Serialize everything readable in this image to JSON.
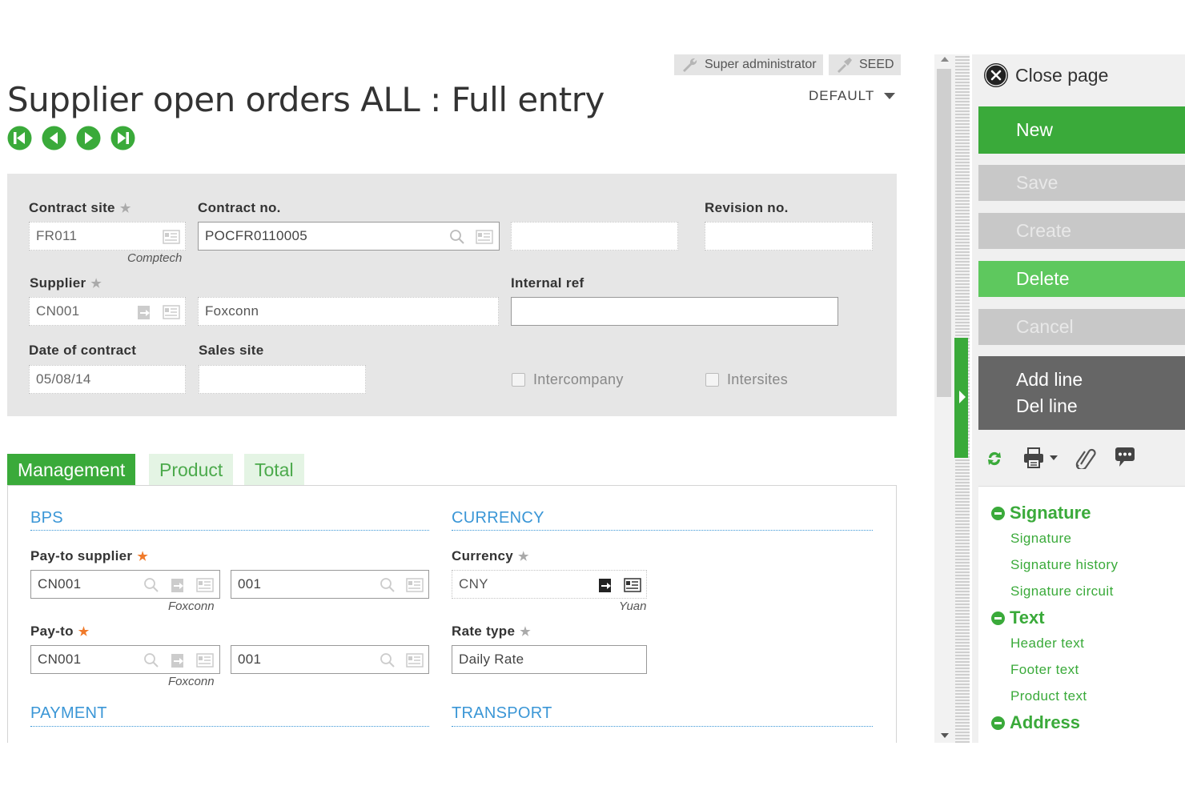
{
  "user": {
    "role": "Super administrator",
    "folder": "SEED"
  },
  "page": {
    "title": "Supplier open orders ALL : Full entry",
    "view": "DEFAULT"
  },
  "header": {
    "contract_site": {
      "label": "Contract site",
      "value": "FR011",
      "desc": "Comptech"
    },
    "contract_no": {
      "label": "Contract no.",
      "value": "POCFR0110005"
    },
    "revision_no": {
      "label": "Revision no.",
      "value": ""
    },
    "supplier": {
      "label": "Supplier",
      "value": "CN001",
      "name": "Foxconn"
    },
    "internal_ref": {
      "label": "Internal ref",
      "value": ""
    },
    "date_of_contract": {
      "label": "Date of contract",
      "value": "05/08/14"
    },
    "sales_site": {
      "label": "Sales site",
      "value": ""
    },
    "intercompany": {
      "label": "Intercompany",
      "checked": false
    },
    "intersites": {
      "label": "Intersites",
      "checked": false
    }
  },
  "tabs": [
    {
      "label": "Management",
      "active": true
    },
    {
      "label": "Product",
      "active": false
    },
    {
      "label": "Total",
      "active": false
    }
  ],
  "management": {
    "bps": {
      "title": "BPS",
      "pay_to_supplier": {
        "label": "Pay-to supplier",
        "value": "CN001",
        "address": "001",
        "desc": "Foxconn"
      },
      "pay_to": {
        "label": "Pay-to",
        "value": "CN001",
        "address": "001",
        "desc": "Foxconn"
      }
    },
    "currency": {
      "title": "CURRENCY",
      "currency": {
        "label": "Currency",
        "value": "CNY",
        "desc": "Yuan"
      },
      "rate_type": {
        "label": "Rate type",
        "value": "Daily Rate"
      }
    },
    "payment_title": "PAYMENT",
    "transport_title": "TRANSPORT"
  },
  "actions": {
    "close_page": "Close page",
    "new": "New",
    "save": "Save",
    "create": "Create",
    "delete": "Delete",
    "cancel": "Cancel",
    "add_line": "Add line",
    "del_line": "Del line"
  },
  "links": {
    "signature": {
      "title": "Signature",
      "items": [
        "Signature",
        "Signature history",
        "Signature circuit"
      ]
    },
    "text": {
      "title": "Text",
      "items": [
        "Header text",
        "Footer text",
        "Product text"
      ]
    },
    "address": {
      "title": "Address"
    }
  },
  "colors": {
    "brand_green": "#3aaa3a",
    "light_green": "#5ec85e",
    "section_blue": "#3a96d6",
    "required_orange": "#f07a2a"
  }
}
